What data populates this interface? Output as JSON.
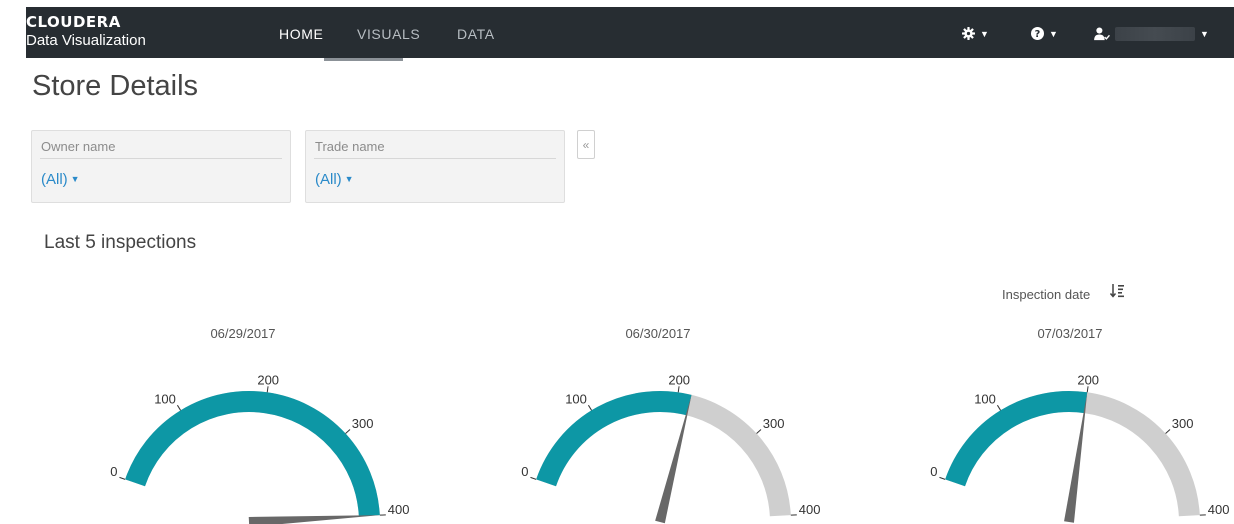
{
  "navbar": {
    "brand_top": "CLOUDERA",
    "brand_sub": "Data Visualization",
    "items": [
      {
        "label": "HOME",
        "active": true
      },
      {
        "label": "VISUALS",
        "active": false
      },
      {
        "label": "DATA",
        "active": false
      }
    ],
    "settings_icon": "gear-icon",
    "help_icon": "question-circle-icon",
    "user_icon": "user-icon",
    "bg_color": "#272d32"
  },
  "page": {
    "title": "Store Details"
  },
  "filters": [
    {
      "label": "Owner name",
      "value": "(All)"
    },
    {
      "label": "Trade name",
      "value": "(All)"
    }
  ],
  "collapse_glyph": "«",
  "section": {
    "title": "Last 5 inspections",
    "sort_label": "Inspection date",
    "sort_icon": "sort-descending-icon"
  },
  "colors": {
    "gauge_fill": "#0d97a5",
    "gauge_bg": "#cfcfcf",
    "needle": "#686868",
    "link": "#2a8ac9"
  },
  "chart_data": {
    "type": "gauge",
    "title": "Last 5 inspections",
    "scale": {
      "min": 0,
      "max": 400,
      "ticks": [
        0,
        100,
        200,
        300,
        400
      ]
    },
    "gauges": [
      {
        "label": "06/29/2017",
        "value": 400
      },
      {
        "label": "06/30/2017",
        "value": 215
      },
      {
        "label": "07/03/2017",
        "value": 200
      }
    ]
  }
}
